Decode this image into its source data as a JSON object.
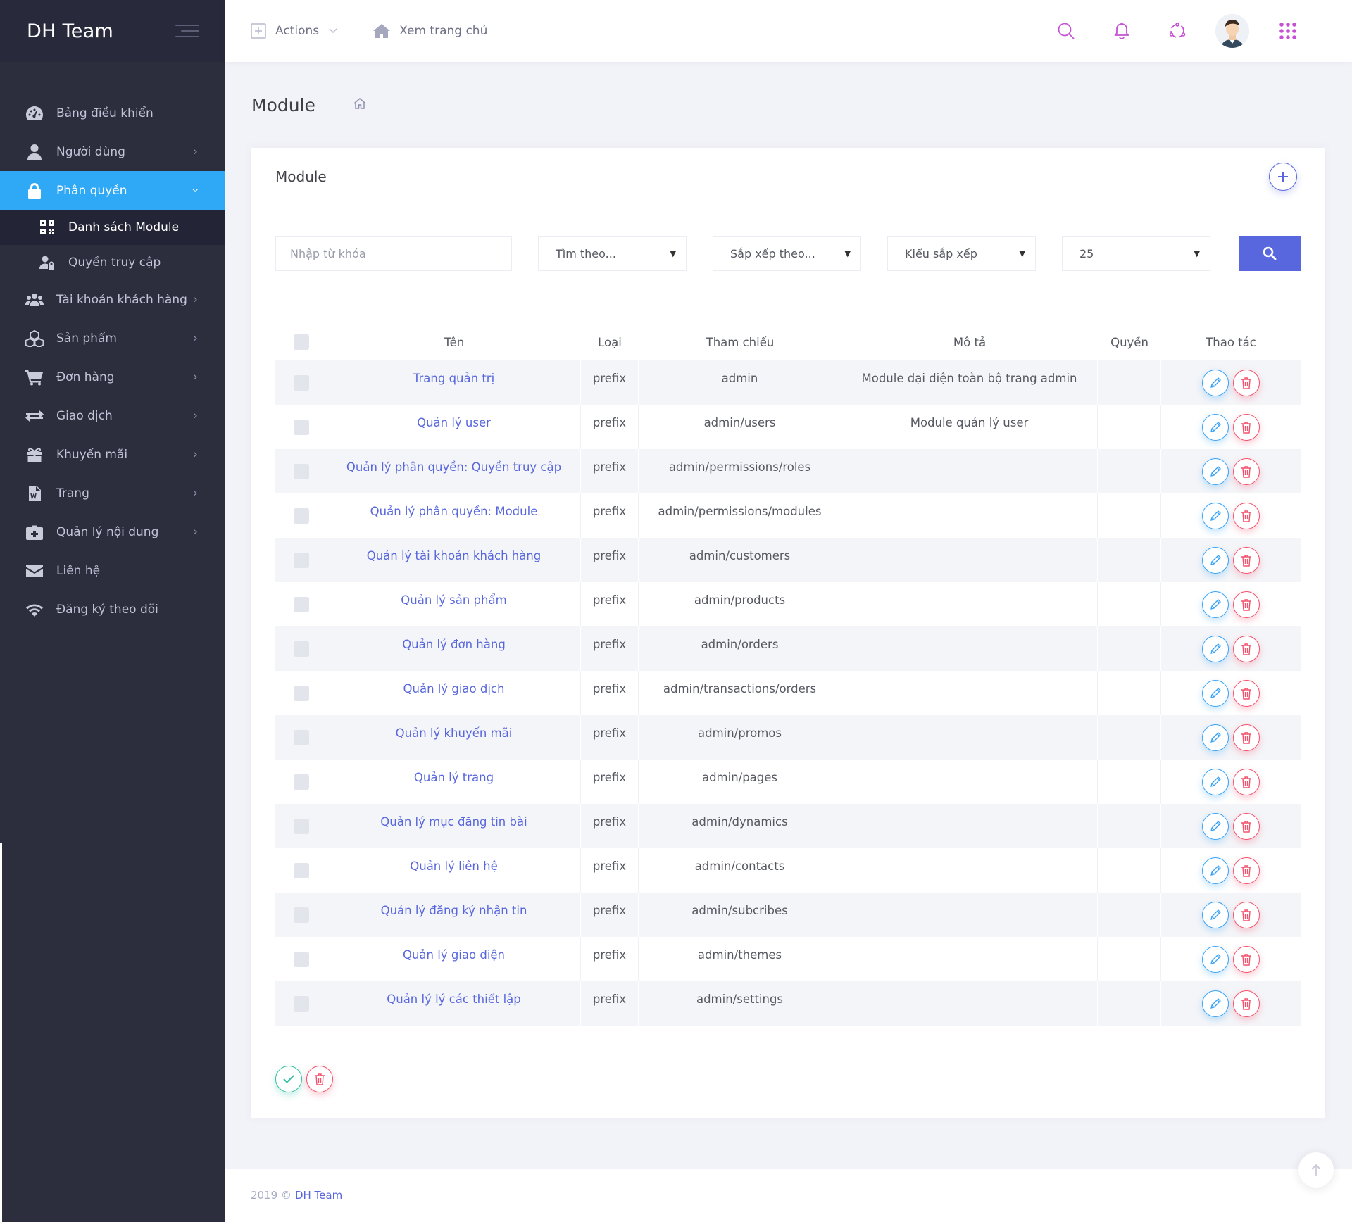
{
  "brand": {
    "name": "DH Team"
  },
  "sidebar": {
    "items": [
      {
        "label": "Bảng điều khiển",
        "icon": "dashboard-icon",
        "chevron": false
      },
      {
        "label": "Người dùng",
        "icon": "user-icon",
        "chevron": true
      },
      {
        "label": "Phân quyền",
        "icon": "lock-icon",
        "chevron": true,
        "active": true,
        "children": [
          {
            "label": "Danh sách Module",
            "icon": "qrcode-icon",
            "current": true
          },
          {
            "label": "Quyền truy cập",
            "icon": "user-lock-icon"
          }
        ]
      },
      {
        "label": "Tài khoản khách hàng",
        "icon": "users-icon",
        "chevron": true
      },
      {
        "label": "Sản phẩm",
        "icon": "cubes-icon",
        "chevron": true
      },
      {
        "label": "Đơn hàng",
        "icon": "cart-icon",
        "chevron": true
      },
      {
        "label": "Giao dịch",
        "icon": "exchange-icon",
        "chevron": true
      },
      {
        "label": "Khuyến mãi",
        "icon": "gift-icon",
        "chevron": true
      },
      {
        "label": "Trang",
        "icon": "word-file-icon",
        "chevron": true
      },
      {
        "label": "Quản lý nội dung",
        "icon": "medkit-icon",
        "chevron": true
      },
      {
        "label": "Liên hệ",
        "icon": "envelope-icon",
        "chevron": false
      },
      {
        "label": "Đăng ký theo dõi",
        "icon": "wifi-icon",
        "chevron": false
      }
    ]
  },
  "header": {
    "actions_label": "Actions",
    "home_label": "Xem trang chủ"
  },
  "page": {
    "title": "Module"
  },
  "portlet": {
    "title": "Module"
  },
  "filters": {
    "keyword_placeholder": "Nhập từ khóa",
    "search_by": "Tìm theo...",
    "sort_by": "Sắp xếp theo...",
    "sort_type": "Kiểu sắp xếp",
    "per_page": "25"
  },
  "table": {
    "columns": [
      "Tên",
      "Loại",
      "Tham chiếu",
      "Mô tả",
      "Quyền",
      "Thao tác"
    ],
    "rows": [
      {
        "name": "Trang quản trị",
        "type": "prefix",
        "ref": "admin",
        "desc": "Module đại diện toàn bộ trang admin",
        "perm": ""
      },
      {
        "name": "Quản lý user",
        "type": "prefix",
        "ref": "admin/users",
        "desc": "Module quản lý user",
        "perm": ""
      },
      {
        "name": "Quản lý phân quyền: Quyền truy cập",
        "type": "prefix",
        "ref": "admin/permissions/roles",
        "desc": "",
        "perm": ""
      },
      {
        "name": "Quản lý phân quyền: Module",
        "type": "prefix",
        "ref": "admin/permissions/modules",
        "desc": "",
        "perm": ""
      },
      {
        "name": "Quản lý tài khoản khách hàng",
        "type": "prefix",
        "ref": "admin/customers",
        "desc": "",
        "perm": ""
      },
      {
        "name": "Quản lý sản phẩm",
        "type": "prefix",
        "ref": "admin/products",
        "desc": "",
        "perm": ""
      },
      {
        "name": "Quản lý đơn hàng",
        "type": "prefix",
        "ref": "admin/orders",
        "desc": "",
        "perm": ""
      },
      {
        "name": "Quản lý giao dịch",
        "type": "prefix",
        "ref": "admin/transactions/orders",
        "desc": "",
        "perm": ""
      },
      {
        "name": "Quản lý khuyến mãi",
        "type": "prefix",
        "ref": "admin/promos",
        "desc": "",
        "perm": ""
      },
      {
        "name": "Quản lý trang",
        "type": "prefix",
        "ref": "admin/pages",
        "desc": "",
        "perm": ""
      },
      {
        "name": "Quản lý mục đăng tin bài",
        "type": "prefix",
        "ref": "admin/dynamics",
        "desc": "",
        "perm": ""
      },
      {
        "name": "Quản lý liên hệ",
        "type": "prefix",
        "ref": "admin/contacts",
        "desc": "",
        "perm": ""
      },
      {
        "name": "Quản lý đăng ký nhận tin",
        "type": "prefix",
        "ref": "admin/subcribes",
        "desc": "",
        "perm": ""
      },
      {
        "name": "Quản lý giao diện",
        "type": "prefix",
        "ref": "admin/themes",
        "desc": "",
        "perm": ""
      },
      {
        "name": "Quản lý lý các thiết lập",
        "type": "prefix",
        "ref": "admin/settings",
        "desc": "",
        "perm": ""
      }
    ]
  },
  "footer": {
    "year": "2019 ©",
    "brand": "DH Team"
  },
  "colors": {
    "sidebar_bg": "#2c2e3e",
    "active_menu": "#2fa8f5",
    "primary": "#5867dd",
    "edit": "#36a3f7",
    "delete": "#f4516c",
    "success": "#34bfa3",
    "header_icons": "#c552d5"
  }
}
